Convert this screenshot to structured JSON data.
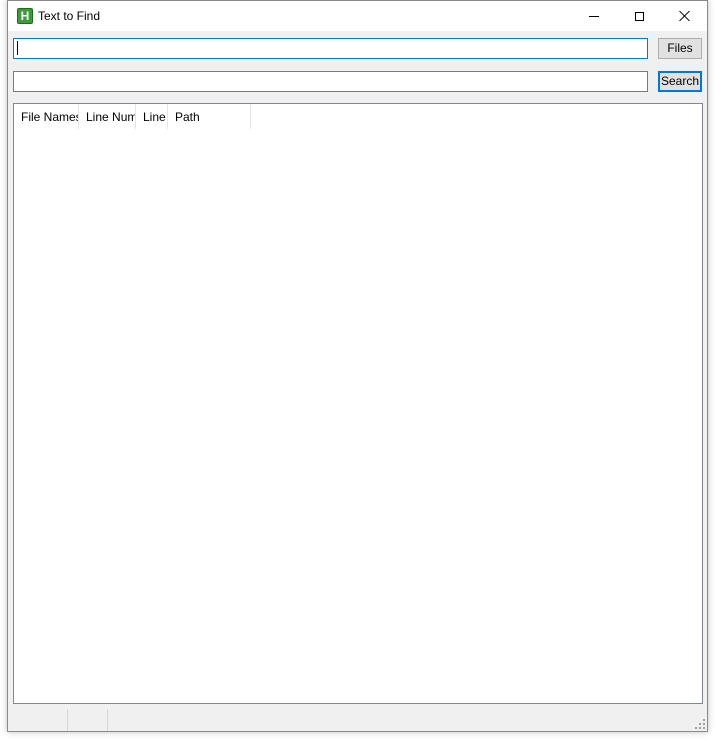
{
  "window": {
    "title": "Text to Find",
    "icon": "app-h-icon",
    "icon_letter": "H",
    "icon_color": "#3e9a3a"
  },
  "inputs": {
    "first_value": "",
    "second_value": ""
  },
  "buttons": {
    "files_label": "Files",
    "search_label": "Search"
  },
  "results": {
    "columns": [
      "File Names",
      "Line Num",
      "Line",
      "Path"
    ],
    "rows": []
  },
  "statusbar": {
    "panels": [
      "",
      ""
    ]
  },
  "colors": {
    "focus_accent": "#0078d7"
  }
}
